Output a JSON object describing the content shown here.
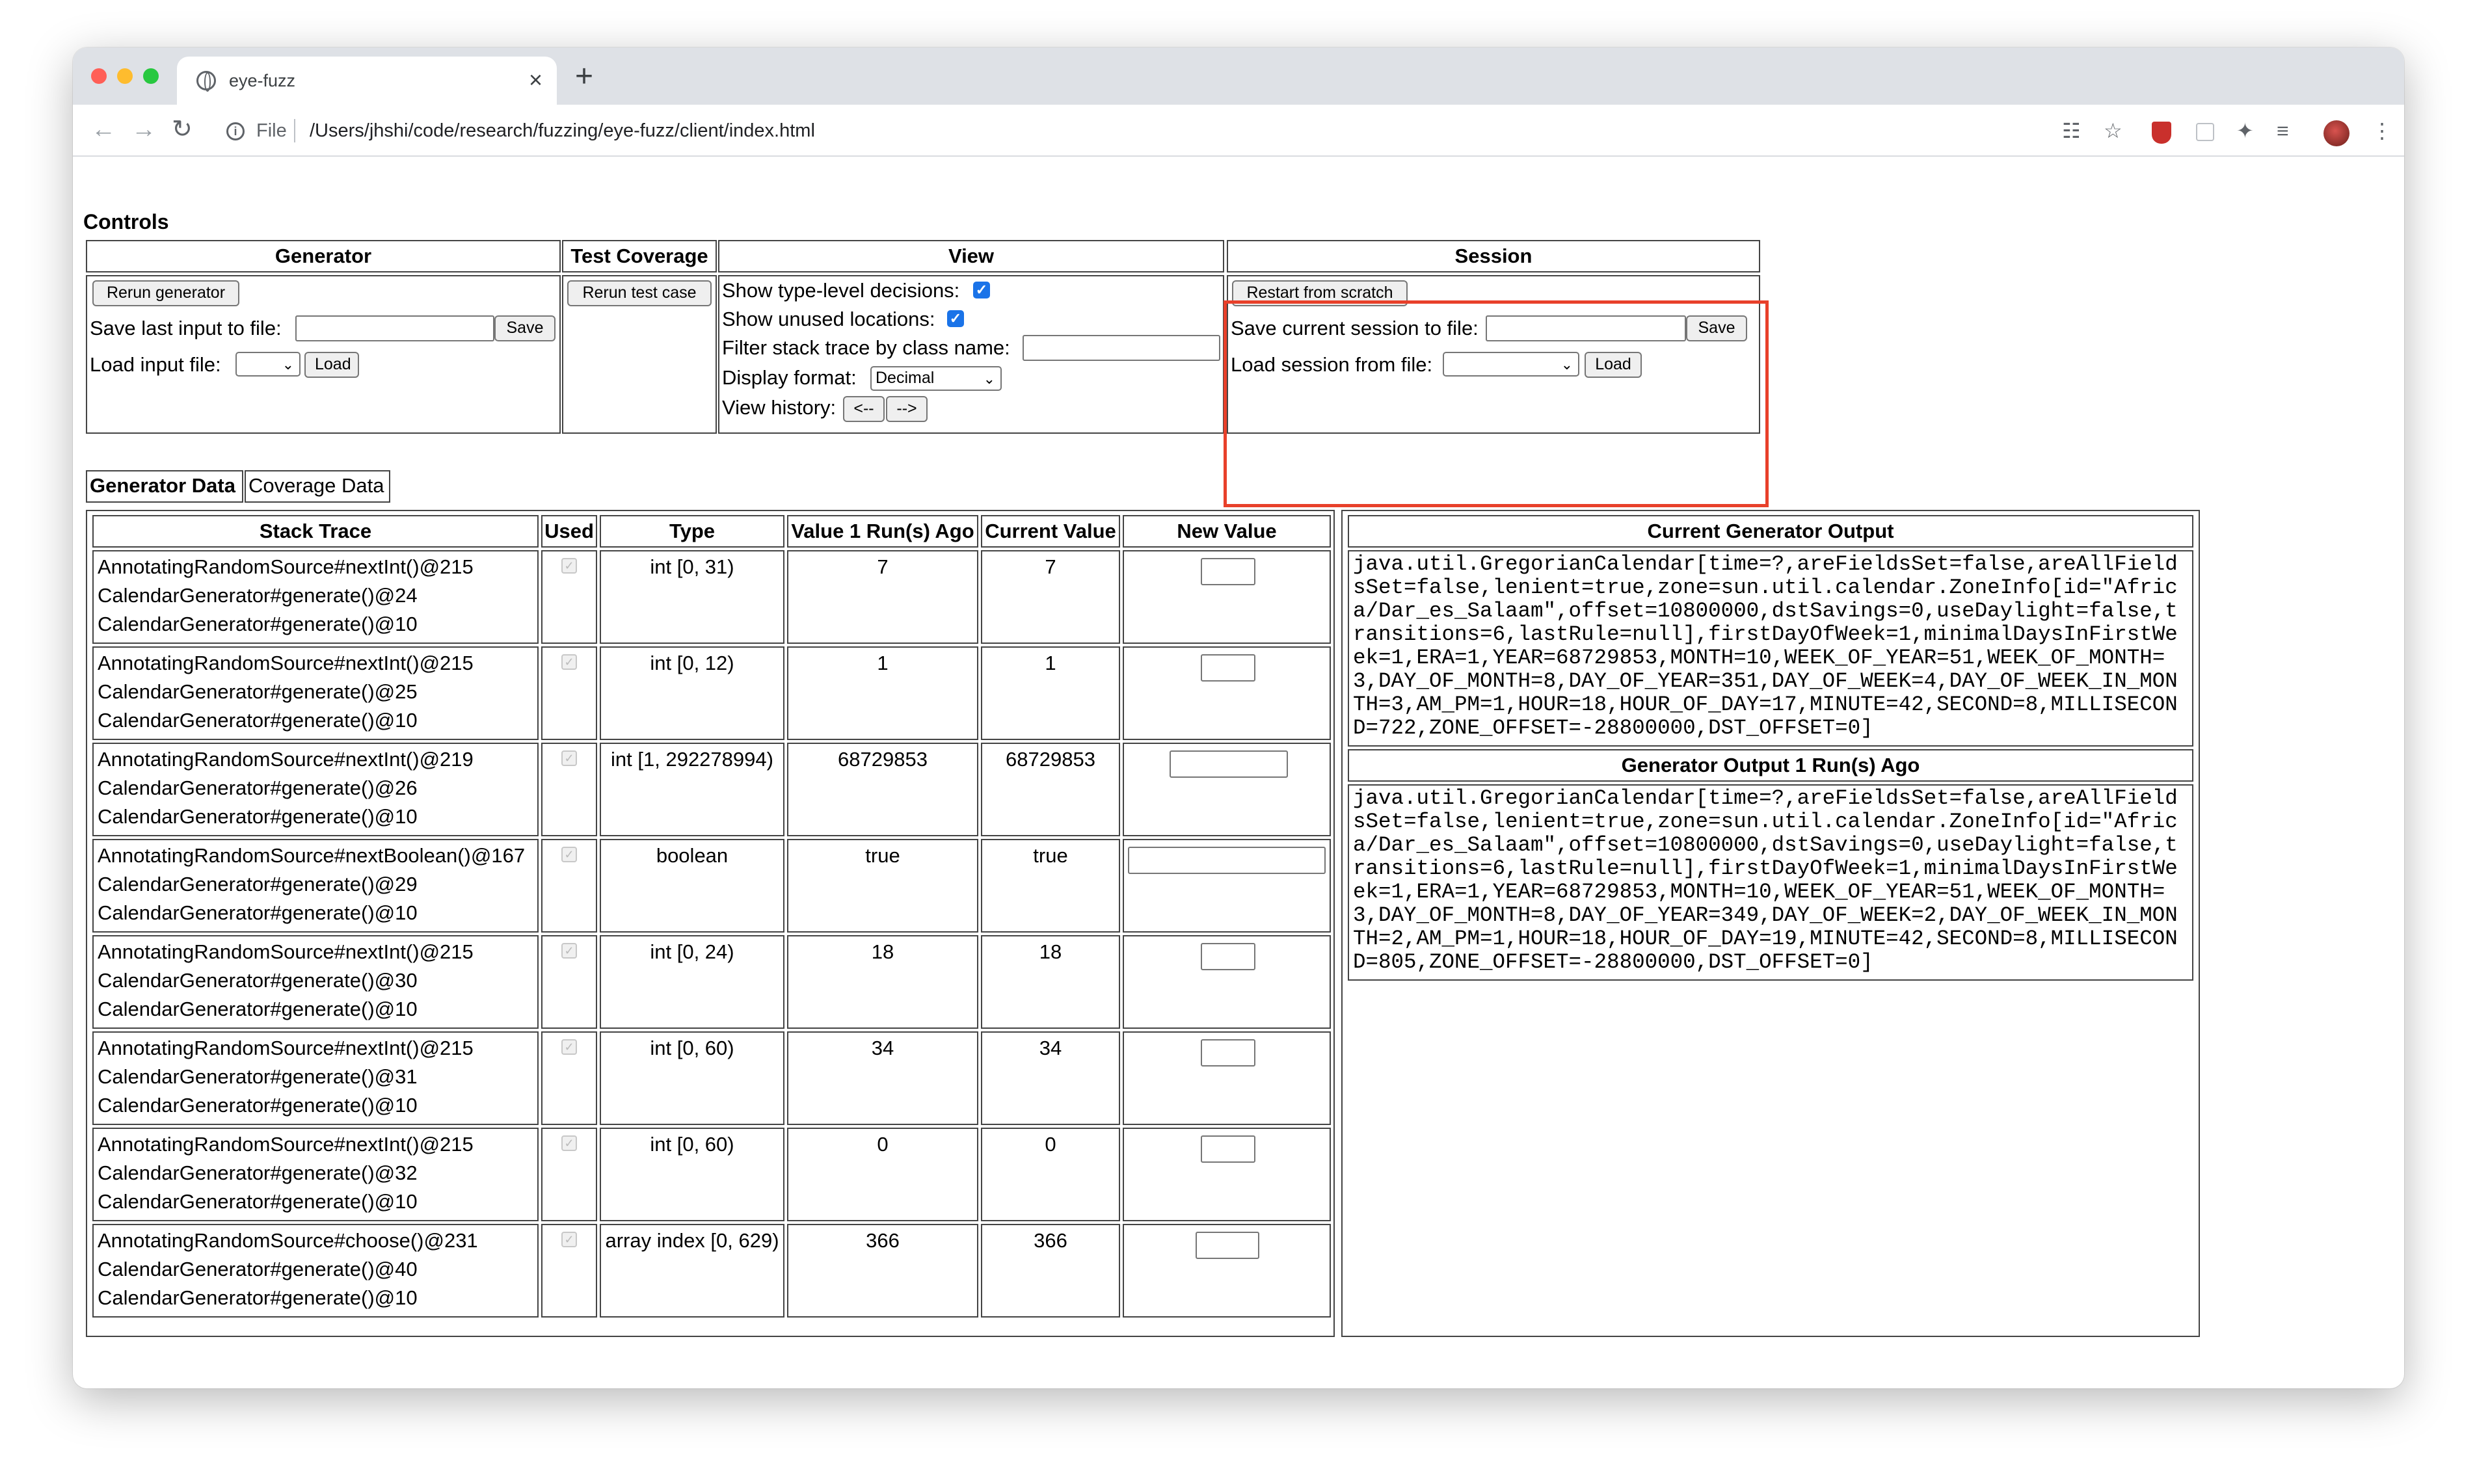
{
  "browser": {
    "tab_title": "eye-fuzz",
    "tab_close": "×",
    "new_tab": "+",
    "url_scheme_label": "File",
    "url_path": "/Users/jhshi/code/research/fuzzing/eye-fuzz/client/index.html"
  },
  "controls": {
    "title": "Controls",
    "generator": {
      "header": "Generator",
      "rerun_button": "Rerun generator",
      "save_label": "Save last input to file:",
      "save_button": "Save",
      "load_label": "Load input file:",
      "load_button": "Load"
    },
    "test_coverage": {
      "header": "Test Coverage",
      "rerun_button": "Rerun test case"
    },
    "view": {
      "header": "View",
      "type_level_label": "Show type-level decisions:",
      "unused_label": "Show unused locations:",
      "filter_label": "Filter stack trace by class name:",
      "display_format_label": "Display format:",
      "display_format_value": "Decimal",
      "history_label": "View history:",
      "history_back": "<--",
      "history_forward": "-->"
    },
    "session": {
      "header": "Session",
      "restart_button": "Restart from scratch",
      "save_label": "Save current session to file:",
      "save_button": "Save",
      "load_label": "Load session from file:",
      "load_button": "Load"
    }
  },
  "data_tabs": [
    "Generator Data",
    "Coverage Data"
  ],
  "generator_table": {
    "headers": [
      "Stack Trace",
      "Used",
      "Type",
      "Value 1 Run(s) Ago",
      "Current Value",
      "New Value"
    ],
    "rows": [
      {
        "trace": [
          "AnnotatingRandomSource#nextInt()@215",
          "CalendarGenerator#generate()@24",
          "CalendarGenerator#generate()@10"
        ],
        "type": "int [0, 31)",
        "prev": "7",
        "current": "7"
      },
      {
        "trace": [
          "AnnotatingRandomSource#nextInt()@215",
          "CalendarGenerator#generate()@25",
          "CalendarGenerator#generate()@10"
        ],
        "type": "int [0, 12)",
        "prev": "1",
        "current": "1"
      },
      {
        "trace": [
          "AnnotatingRandomSource#nextInt()@219",
          "CalendarGenerator#generate()@26",
          "CalendarGenerator#generate()@10"
        ],
        "type": "int [1, 292278994)",
        "prev": "68729853",
        "current": "68729853"
      },
      {
        "trace": [
          "AnnotatingRandomSource#nextBoolean()@167",
          "CalendarGenerator#generate()@29",
          "CalendarGenerator#generate()@10"
        ],
        "type": "boolean",
        "prev": "true",
        "current": "true"
      },
      {
        "trace": [
          "AnnotatingRandomSource#nextInt()@215",
          "CalendarGenerator#generate()@30",
          "CalendarGenerator#generate()@10"
        ],
        "type": "int [0, 24)",
        "prev": "18",
        "current": "18"
      },
      {
        "trace": [
          "AnnotatingRandomSource#nextInt()@215",
          "CalendarGenerator#generate()@31",
          "CalendarGenerator#generate()@10"
        ],
        "type": "int [0, 60)",
        "prev": "34",
        "current": "34"
      },
      {
        "trace": [
          "AnnotatingRandomSource#nextInt()@215",
          "CalendarGenerator#generate()@32",
          "CalendarGenerator#generate()@10"
        ],
        "type": "int [0, 60)",
        "prev": "0",
        "current": "0"
      },
      {
        "trace": [
          "AnnotatingRandomSource#choose()@231",
          "CalendarGenerator#generate()@40",
          "CalendarGenerator#generate()@10"
        ],
        "type": "array index [0, 629)",
        "prev": "366",
        "current": "366"
      }
    ]
  },
  "outputs": {
    "current_header": "Current Generator Output",
    "current_text": "java.util.GregorianCalendar[time=?,areFieldsSet=false,areAllFieldsSet=false,lenient=true,zone=sun.util.calendar.ZoneInfo[id=\"Africa/Dar_es_Salaam\",offset=10800000,dstSavings=0,useDaylight=false,transitions=6,lastRule=null],firstDayOfWeek=1,minimalDaysInFirstWeek=1,ERA=1,YEAR=68729853,MONTH=10,WEEK_OF_YEAR=51,WEEK_OF_MONTH=3,DAY_OF_MONTH=8,DAY_OF_YEAR=351,DAY_OF_WEEK=4,DAY_OF_WEEK_IN_MONTH=3,AM_PM=1,HOUR=18,HOUR_OF_DAY=17,MINUTE=42,SECOND=8,MILLISECOND=722,ZONE_OFFSET=-28800000,DST_OFFSET=0]",
    "previous_header": "Generator Output 1 Run(s) Ago",
    "previous_text": "java.util.GregorianCalendar[time=?,areFieldsSet=false,areAllFieldsSet=false,lenient=true,zone=sun.util.calendar.ZoneInfo[id=\"Africa/Dar_es_Salaam\",offset=10800000,dstSavings=0,useDaylight=false,transitions=6,lastRule=null],firstDayOfWeek=1,minimalDaysInFirstWeek=1,ERA=1,YEAR=68729853,MONTH=10,WEEK_OF_YEAR=51,WEEK_OF_MONTH=3,DAY_OF_MONTH=8,DAY_OF_YEAR=349,DAY_OF_WEEK=2,DAY_OF_WEEK_IN_MONTH=2,AM_PM=1,HOUR=18,HOUR_OF_DAY=19,MINUTE=42,SECOND=8,MILLISECOND=805,ZONE_OFFSET=-28800000,DST_OFFSET=0]"
  },
  "colors": {
    "highlight": "#e8402a",
    "checkbox": "#1a73e8"
  }
}
